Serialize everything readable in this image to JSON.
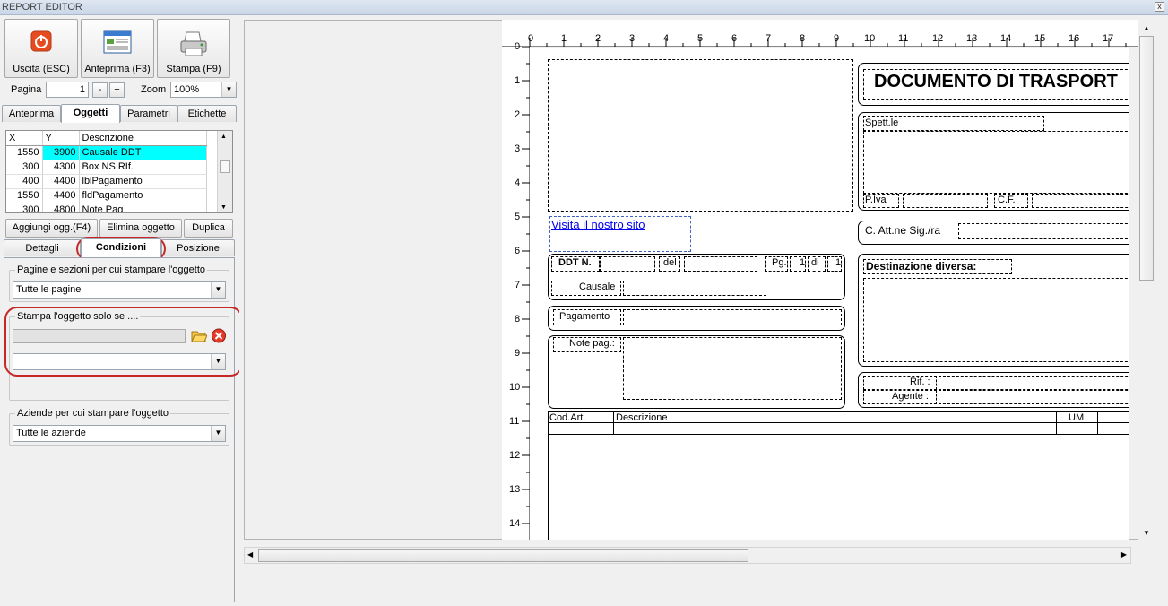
{
  "window": {
    "title": "REPORT EDITOR",
    "close": "x"
  },
  "toolbar": {
    "exit_label": "Uscita (ESC)",
    "preview_label": "Anteprima (F3)",
    "print_label": "Stampa (F9)"
  },
  "pager": {
    "page_label": "Pagina",
    "page_value": "1",
    "prev": "-",
    "next": "+",
    "zoom_label": "Zoom",
    "zoom_value": "100%"
  },
  "tabs1": [
    "Anteprima",
    "Oggetti",
    "Parametri",
    "Etichette"
  ],
  "grid": {
    "headers": [
      "X",
      "Y",
      "Descrizione"
    ],
    "rows": [
      {
        "x": "1550",
        "y": "3900",
        "d": "Causale DDT"
      },
      {
        "x": "300",
        "y": "4300",
        "d": "Box NS RIf."
      },
      {
        "x": "400",
        "y": "4400",
        "d": "lblPagamento"
      },
      {
        "x": "1550",
        "y": "4400",
        "d": "fldPagamento"
      },
      {
        "x": "300",
        "y": "4800",
        "d": "Note Pag"
      }
    ]
  },
  "actions": {
    "add": "Aggiungi ogg.(F4)",
    "delete": "Elimina oggetto",
    "dup": "Duplica"
  },
  "tabs2": [
    "Dettagli",
    "Condizioni",
    "Posizione"
  ],
  "cond": {
    "pages_group": "Pagine e sezioni per cui stampare l'oggetto",
    "pages_value": "Tutte le pagine",
    "print_if_group": "Stampa l'oggetto solo se ....",
    "print_if_value": "",
    "companies_group": "Aziende per cui stampare l'oggetto",
    "companies_value": "Tutte le aziende"
  },
  "ruler": {
    "top": [
      "0",
      "1",
      "2",
      "3",
      "4",
      "5",
      "6",
      "7",
      "8",
      "9",
      "10",
      "11",
      "12",
      "13",
      "14",
      "15",
      "16",
      "17"
    ],
    "left": [
      "0",
      "1",
      "2",
      "3",
      "4",
      "5",
      "6",
      "7",
      "8",
      "9",
      "10",
      "11",
      "12",
      "13",
      "14"
    ]
  },
  "report": {
    "title": "DOCUMENTO DI TRASPORT",
    "spett": "Spett.le",
    "piva": "P.Iva",
    "cf": "C.F.",
    "link": "Visita il nostro sito",
    "att": "C. Att.ne Sig./ra",
    "ddt": "DDT N.",
    "del": "del",
    "pg": "Pg.",
    "pg_num": "1",
    "di": "di",
    "pg_tot": "1",
    "causale": "Causale",
    "dest": "Destinazione diversa:",
    "pagamento": "Pagamento",
    "note": "Note pag.:",
    "rif": "Rif. :",
    "agente": "Agente :",
    "col_code": "Cod.Art.",
    "col_desc": "Descrizione",
    "col_um": "UM"
  },
  "colors": {
    "selection": "#00ffff",
    "highlight": "#c62828",
    "link": "#0000ee"
  }
}
